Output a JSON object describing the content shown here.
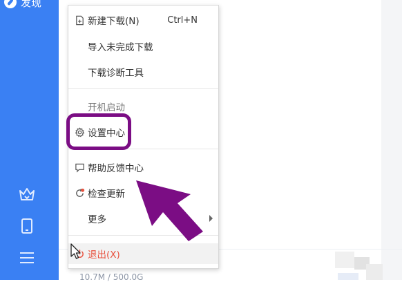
{
  "sidebar": {
    "discover_label": "发现",
    "icons": [
      "crown-icon",
      "phone-icon",
      "hamburger-menu-icon"
    ]
  },
  "main": {
    "storage_text": "10.7M / 500.0G"
  },
  "menu": {
    "new_download": {
      "label": "新建下载(N)",
      "shortcut": "Ctrl+N",
      "icon": "new-download-icon"
    },
    "import_incomplete": {
      "label": "导入未完成下载"
    },
    "diagnostics": {
      "label": "下载诊断工具"
    },
    "startup": {
      "label": "开机启动"
    },
    "settings": {
      "label": "设置中心",
      "icon": "gear-icon"
    },
    "help_feedback": {
      "label": "帮助反馈中心",
      "icon": "chat-bubble-icon"
    },
    "check_update": {
      "label": "检查更新",
      "icon": "update-icon"
    },
    "more": {
      "label": "更多"
    },
    "exit": {
      "label": "退出(X)",
      "icon": "power-icon"
    }
  },
  "colors": {
    "sidebar": "#3a80f3",
    "annotation": "#7b0d84",
    "exit_text": "#e8523f",
    "update_badge": "#e8523f"
  }
}
